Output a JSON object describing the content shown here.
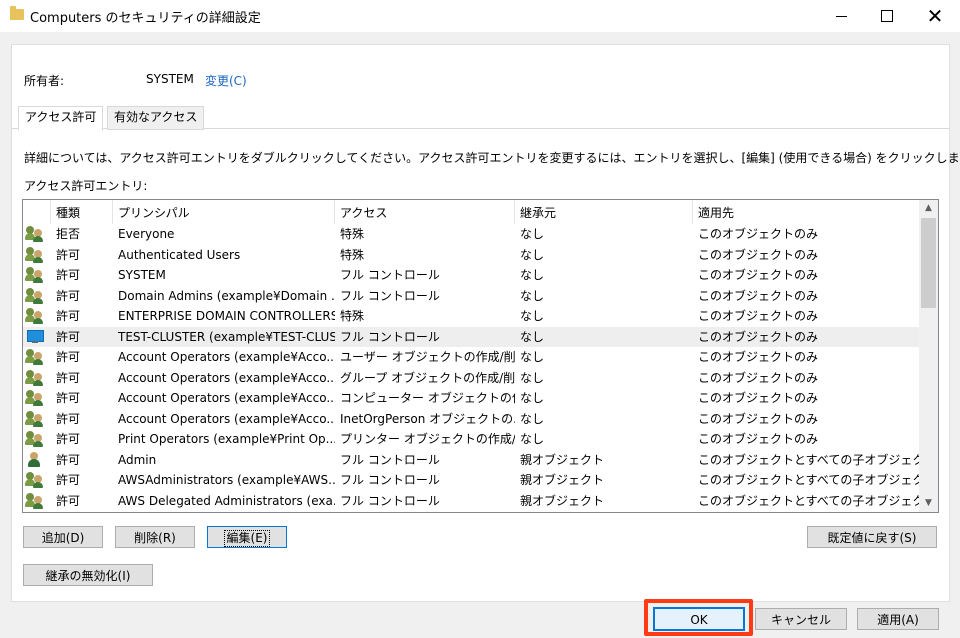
{
  "window": {
    "title": "Computers のセキュリティの詳細設定",
    "close_glyph": "✕"
  },
  "owner": {
    "label": "所有者:",
    "value": "SYSTEM",
    "change_link": "変更(C)"
  },
  "tabs": [
    {
      "label": "アクセス許可",
      "active": true
    },
    {
      "label": "有効なアクセス",
      "active": false
    }
  ],
  "instruction": "詳細については、アクセス許可エントリをダブルクリックしてください。アクセス許可エントリを変更するには、エントリを選択し、[編集] (使用できる場合) をクリックします。",
  "entries_label": "アクセス許可エントリ:",
  "columns": {
    "type": "種類",
    "principal": "プリンシパル",
    "access": "アクセス",
    "inherited_from": "継承元",
    "applies_to": "適用先"
  },
  "rows": [
    {
      "icon": "group-icon",
      "type": "拒否",
      "principal": "Everyone",
      "access": "特殊",
      "inherited_from": "なし",
      "applies_to": "このオブジェクトのみ"
    },
    {
      "icon": "group-icon",
      "type": "許可",
      "principal": "Authenticated Users",
      "access": "特殊",
      "inherited_from": "なし",
      "applies_to": "このオブジェクトのみ"
    },
    {
      "icon": "group-icon",
      "type": "許可",
      "principal": "SYSTEM",
      "access": "フル コントロール",
      "inherited_from": "なし",
      "applies_to": "このオブジェクトのみ"
    },
    {
      "icon": "group-icon",
      "type": "許可",
      "principal": "Domain Admins (example¥Domain ...",
      "access": "フル コントロール",
      "inherited_from": "なし",
      "applies_to": "このオブジェクトのみ"
    },
    {
      "icon": "group-icon",
      "type": "許可",
      "principal": "ENTERPRISE DOMAIN CONTROLLERS",
      "access": "特殊",
      "inherited_from": "なし",
      "applies_to": "このオブジェクトのみ"
    },
    {
      "icon": "computer-icon",
      "type": "許可",
      "principal": "TEST-CLUSTER (example¥TEST-CLUS...",
      "access": "フル コントロール",
      "inherited_from": "なし",
      "applies_to": "このオブジェクトのみ",
      "selected": true
    },
    {
      "icon": "group-icon",
      "type": "許可",
      "principal": "Account Operators (example¥Acco...",
      "access": "ユーザー オブジェクトの作成/削除",
      "inherited_from": "なし",
      "applies_to": "このオブジェクトのみ"
    },
    {
      "icon": "group-icon",
      "type": "許可",
      "principal": "Account Operators (example¥Acco...",
      "access": "グループ オブジェクトの作成/削除",
      "inherited_from": "なし",
      "applies_to": "このオブジェクトのみ"
    },
    {
      "icon": "group-icon",
      "type": "許可",
      "principal": "Account Operators (example¥Acco...",
      "access": "コンピューター オブジェクトの作...",
      "inherited_from": "なし",
      "applies_to": "このオブジェクトのみ"
    },
    {
      "icon": "group-icon",
      "type": "許可",
      "principal": "Account Operators (example¥Acco...",
      "access": "InetOrgPerson オブジェクトの...",
      "inherited_from": "なし",
      "applies_to": "このオブジェクトのみ"
    },
    {
      "icon": "group-icon",
      "type": "許可",
      "principal": "Print Operators (example¥Print Op...",
      "access": "プリンター オブジェクトの作成/...",
      "inherited_from": "なし",
      "applies_to": "このオブジェクトのみ"
    },
    {
      "icon": "user-icon",
      "type": "許可",
      "principal": "Admin",
      "access": "フル コントロール",
      "inherited_from": "親オブジェクト",
      "applies_to": "このオブジェクトとすべての子オブジェクト"
    },
    {
      "icon": "group-icon",
      "type": "許可",
      "principal": "AWSAdministrators (example¥AWS...",
      "access": "フル コントロール",
      "inherited_from": "親オブジェクト",
      "applies_to": "このオブジェクトとすべての子オブジェクト"
    },
    {
      "icon": "group-icon",
      "type": "許可",
      "principal": "AWS Delegated Administrators (exa...",
      "access": "フル コントロール",
      "inherited_from": "親オブジェクト",
      "applies_to": "このオブジェクトとすべての子オブジェクト"
    }
  ],
  "buttons": {
    "add": "追加(D)",
    "remove": "削除(R)",
    "edit": "編集(E)",
    "restore_defaults": "既定値に戻す(S)",
    "disable_inheritance": "継承の無効化(I)",
    "ok": "OK",
    "cancel": "キャンセル",
    "apply": "適用(A)"
  },
  "colors": {
    "link": "#1a66c2",
    "selection_highlight": "#ff3a14",
    "focus": "#0078d7"
  }
}
